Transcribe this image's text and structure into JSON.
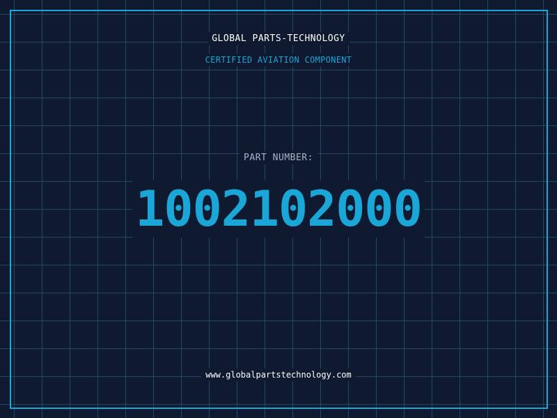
{
  "label": {
    "company": "GLOBAL PARTS-TECHNOLOGY",
    "tagline": "CERTIFIED AVIATION COMPONENT",
    "part_label": "PART NUMBER:",
    "part_number": "1002102000",
    "website": "www.globalpartstechnology.com"
  },
  "colors": {
    "background": "#0f1a30",
    "grid": "#1e4a66",
    "accent": "#1aa6d6",
    "text": "#ffffff",
    "muted": "#a8b3c4"
  }
}
